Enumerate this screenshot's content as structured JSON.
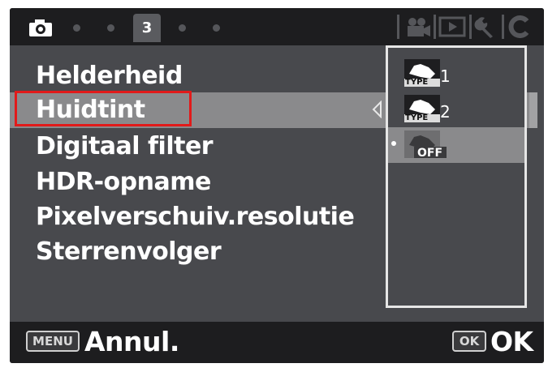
{
  "topbar": {
    "active_tab": "3",
    "tabs": [
      "camera-icon",
      "dot",
      "dot",
      "3",
      "dot",
      "dot"
    ],
    "right_icons": [
      "movie-icon",
      "playback-icon",
      "wrench-icon",
      "custom-c-icon"
    ]
  },
  "menu": {
    "items": [
      {
        "label": "Helderheid"
      },
      {
        "label": "Huidtint"
      },
      {
        "label": "Digitaal filter"
      },
      {
        "label": "HDR-opname"
      },
      {
        "label": "Pixelverschuiv.resolutie"
      },
      {
        "label": "Sterrenvolger"
      }
    ],
    "selected_index": 1
  },
  "options": {
    "items": [
      {
        "icon": "skin-tone-type1-icon",
        "suffix": "1",
        "tag": "TYPE"
      },
      {
        "icon": "skin-tone-type2-icon",
        "suffix": "2",
        "tag": "TYPE"
      },
      {
        "icon": "skin-tone-off-icon",
        "suffix": "",
        "tag": "OFF"
      }
    ],
    "selected_index": 2
  },
  "bottombar": {
    "menu_key": "MENU",
    "cancel_label": "Annul.",
    "ok_key": "OK",
    "ok_label": "OK"
  },
  "colors": {
    "screen_bg": "#48494d",
    "bar_bg": "#1d1d1f",
    "highlight": "#e21a1a",
    "selection_band": "#8a8a8c"
  }
}
